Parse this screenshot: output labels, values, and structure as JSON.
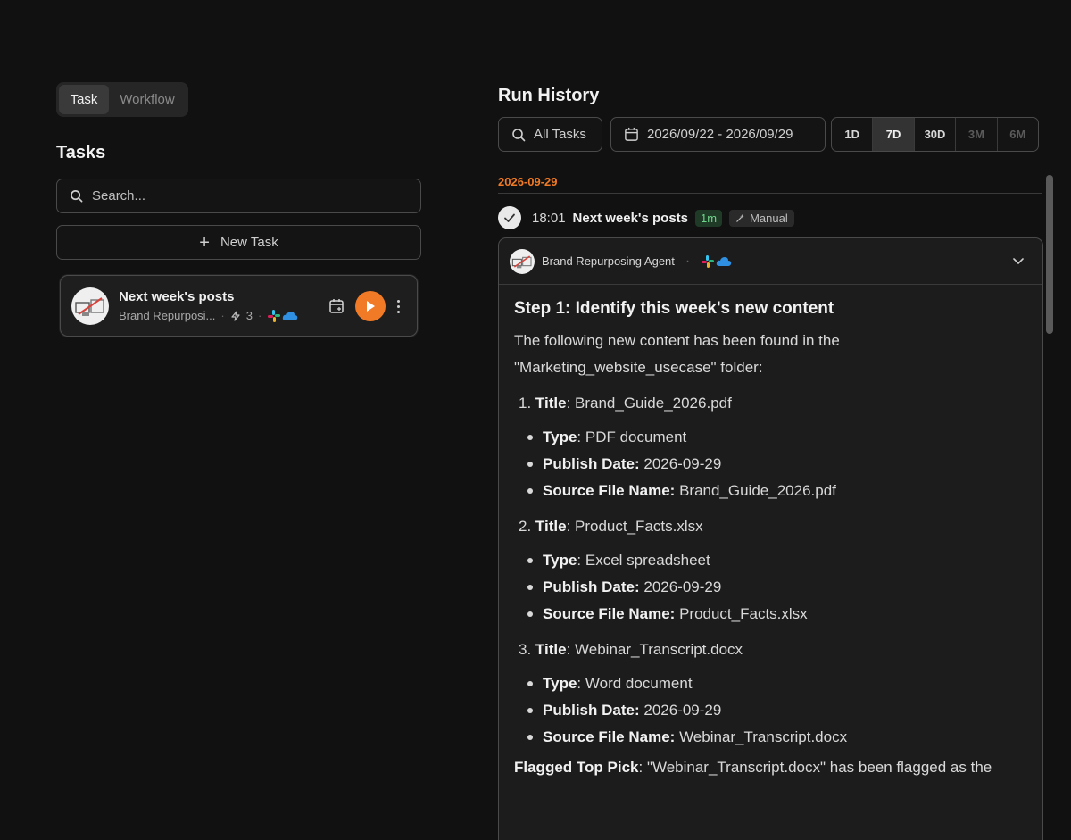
{
  "left": {
    "segments": [
      "Task",
      "Workflow"
    ],
    "tasks_title": "Tasks",
    "search_placeholder": "Search...",
    "new_task_label": "New Task",
    "task": {
      "name": "Next week's posts",
      "agent": "Brand Repurposi...",
      "tool_count": "3"
    }
  },
  "right": {
    "title": "Run History",
    "filter_tasks": "All Tasks",
    "date_range": "2026/09/22 - 2026/09/29",
    "ranges": [
      "1D",
      "7D",
      "30D",
      "3M",
      "6M"
    ],
    "selected_range": "7D",
    "date_group": "2026-09-29",
    "run": {
      "time": "18:01",
      "name": "Next week's posts",
      "duration": "1m",
      "trigger": "Manual"
    },
    "agent_name": "Brand Repurposing Agent",
    "content": {
      "heading": "Step 1: Identify this week's new content",
      "intro_1": "The following new content has been found in the",
      "intro_2": "\"Marketing_website_usecase\" folder:",
      "items": [
        {
          "num": "1.",
          "title_label": "Title",
          "title": "Brand_Guide_2026.pdf",
          "type_label": "Type",
          "type": "PDF document",
          "date_label": "Publish Date:",
          "date": "2026-09-29",
          "source_label": "Source File Name:",
          "source": "Brand_Guide_2026.pdf"
        },
        {
          "num": "2.",
          "title_label": "Title",
          "title": "Product_Facts.xlsx",
          "type_label": "Type",
          "type": "Excel spreadsheet",
          "date_label": "Publish Date:",
          "date": "2026-09-29",
          "source_label": "Source File Name:",
          "source": "Product_Facts.xlsx"
        },
        {
          "num": "3.",
          "title_label": "Title",
          "title": "Webinar_Transcript.docx",
          "type_label": "Type",
          "type": "Word document",
          "date_label": "Publish Date:",
          "date": "2026-09-29",
          "source_label": "Source File Name:",
          "source": "Webinar_Transcript.docx"
        }
      ],
      "flag_label": "Flagged Top Pick",
      "flag_text": "\"Webinar_Transcript.docx\" has been flagged as the"
    }
  },
  "colors": {
    "background": "#111111",
    "accent_orange": "#f07a26",
    "duration_badge_text": "#6fd58a"
  },
  "icons": [
    "search-icon",
    "plus-icon",
    "calendar-icon",
    "play-icon",
    "more-icon",
    "check-icon",
    "sparkle-icon",
    "chevron-down-icon",
    "slack-icon",
    "cloud-icon",
    "bolt-icon"
  ]
}
